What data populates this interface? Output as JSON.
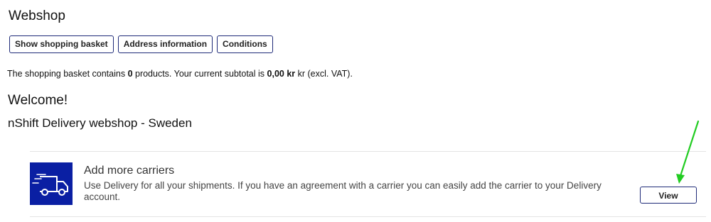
{
  "header": {
    "title": "Webshop"
  },
  "toolbar": {
    "buttons": [
      {
        "label": "Show shopping basket"
      },
      {
        "label": "Address information"
      },
      {
        "label": "Conditions"
      }
    ]
  },
  "basket": {
    "prefix": "The shopping basket contains ",
    "count": "0",
    "middle": " products. Your current subtotal is ",
    "subtotal": "0,00 kr",
    "suffix": " kr (excl. VAT)."
  },
  "welcome": {
    "heading": "Welcome!",
    "subtitle": "nShift Delivery webshop - Sweden"
  },
  "card": {
    "icon": "delivery-truck-icon",
    "title": "Add more carriers",
    "description": "Use Delivery for all your shipments. If you have an agreement with a carrier you can easily add the carrier to your Delivery account.",
    "action_label": "View"
  },
  "colors": {
    "accent": "#0a1fa3",
    "button_border": "#1e2a78",
    "annotation_arrow": "#22cc22",
    "divider": "#e3e3e3"
  }
}
